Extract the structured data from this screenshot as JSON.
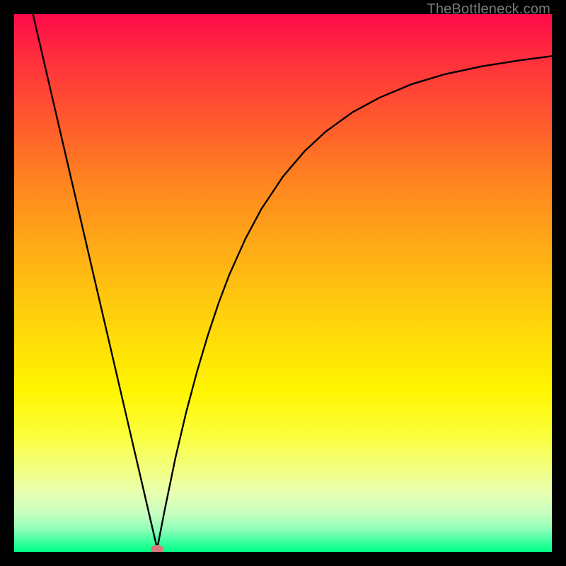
{
  "watermark": "TheBottleneck.com",
  "chart_data": {
    "type": "line",
    "title": "",
    "xlabel": "",
    "ylabel": "",
    "xlim": [
      0,
      1
    ],
    "ylim": [
      0,
      1
    ],
    "marker": {
      "x": 0.266,
      "y": 0.005,
      "color": "#d9797c"
    },
    "series": [
      {
        "name": "curve",
        "segment": "left",
        "x": [
          0.035,
          0.06,
          0.09,
          0.12,
          0.15,
          0.18,
          0.21,
          0.24,
          0.266
        ],
        "y": [
          1.0,
          0.892,
          0.763,
          0.634,
          0.505,
          0.376,
          0.247,
          0.118,
          0.006
        ]
      },
      {
        "name": "curve",
        "segment": "right",
        "x": [
          0.266,
          0.28,
          0.3,
          0.32,
          0.34,
          0.36,
          0.38,
          0.4,
          0.43,
          0.46,
          0.5,
          0.54,
          0.58,
          0.63,
          0.68,
          0.74,
          0.8,
          0.87,
          0.94,
          1.0
        ],
        "y": [
          0.006,
          0.078,
          0.175,
          0.26,
          0.335,
          0.402,
          0.462,
          0.515,
          0.582,
          0.638,
          0.698,
          0.745,
          0.782,
          0.818,
          0.845,
          0.87,
          0.888,
          0.903,
          0.914,
          0.922
        ]
      }
    ],
    "gradient_stops": [
      {
        "pos": 0.0,
        "color": "#ff0a4a"
      },
      {
        "pos": 0.08,
        "color": "#ff2e3d"
      },
      {
        "pos": 0.2,
        "color": "#ff5a2d"
      },
      {
        "pos": 0.32,
        "color": "#ff871f"
      },
      {
        "pos": 0.45,
        "color": "#ffb015"
      },
      {
        "pos": 0.58,
        "color": "#ffd60a"
      },
      {
        "pos": 0.7,
        "color": "#fff500"
      },
      {
        "pos": 0.78,
        "color": "#fcff3a"
      },
      {
        "pos": 0.84,
        "color": "#f4ff7a"
      },
      {
        "pos": 0.89,
        "color": "#e7ffb0"
      },
      {
        "pos": 0.93,
        "color": "#c5ffc0"
      },
      {
        "pos": 0.96,
        "color": "#8affb8"
      },
      {
        "pos": 0.98,
        "color": "#3effa0"
      },
      {
        "pos": 1.0,
        "color": "#00ff86"
      }
    ]
  }
}
